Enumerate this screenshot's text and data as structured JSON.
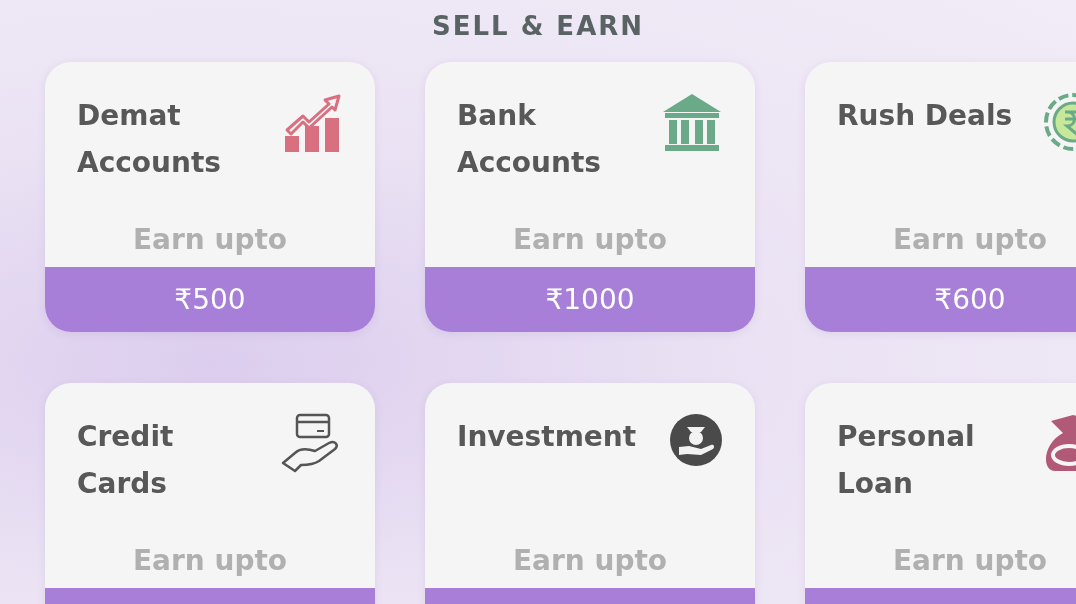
{
  "heading": "SELL & EARN",
  "cards": [
    {
      "title": "Demat Accounts",
      "caption": "Earn upto",
      "amount": "₹500"
    },
    {
      "title": "Bank Accounts",
      "caption": "Earn upto",
      "amount": "₹1000"
    },
    {
      "title": "Rush Deals",
      "caption": "Earn upto",
      "amount": "₹600"
    },
    {
      "title": "Credit Cards",
      "caption": "Earn upto"
    },
    {
      "title": "Investment",
      "caption": "Earn upto"
    },
    {
      "title": "Personal Loan",
      "caption": "Earn upto"
    }
  ]
}
